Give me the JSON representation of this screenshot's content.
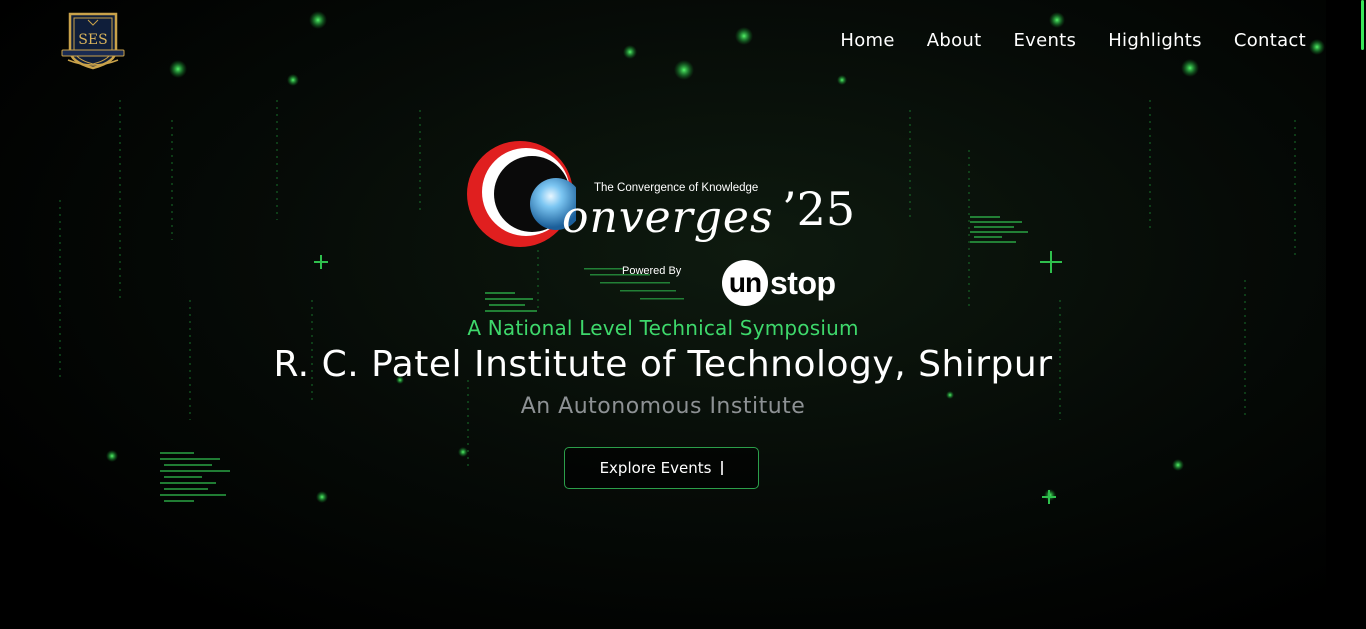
{
  "logo": {
    "text": "SES",
    "alt": "Shirpur Education Society"
  },
  "nav": {
    "items": [
      {
        "label": "Home"
      },
      {
        "label": "About"
      },
      {
        "label": "Events"
      },
      {
        "label": "Highlights"
      },
      {
        "label": "Contact"
      }
    ]
  },
  "brand": {
    "tagline": "The Convergence of Knowledge",
    "word": "onverges",
    "year": "’25",
    "powered_by": "Powered By",
    "sponsor_circle": "un",
    "sponsor_rest": "stop"
  },
  "hero": {
    "subtitle": "A National Level Technical Symposium",
    "institute": "R. C. Patel Institute of Technology, Shirpur",
    "tag": "An Autonomous Institute",
    "cta_label": "Explore Events"
  },
  "colors": {
    "accent_green": "#3ed86b",
    "background": "#000000",
    "ring_red": "#e01f1f",
    "ring_blue": "#4aa3e8",
    "muted_text": "#8d9194"
  }
}
